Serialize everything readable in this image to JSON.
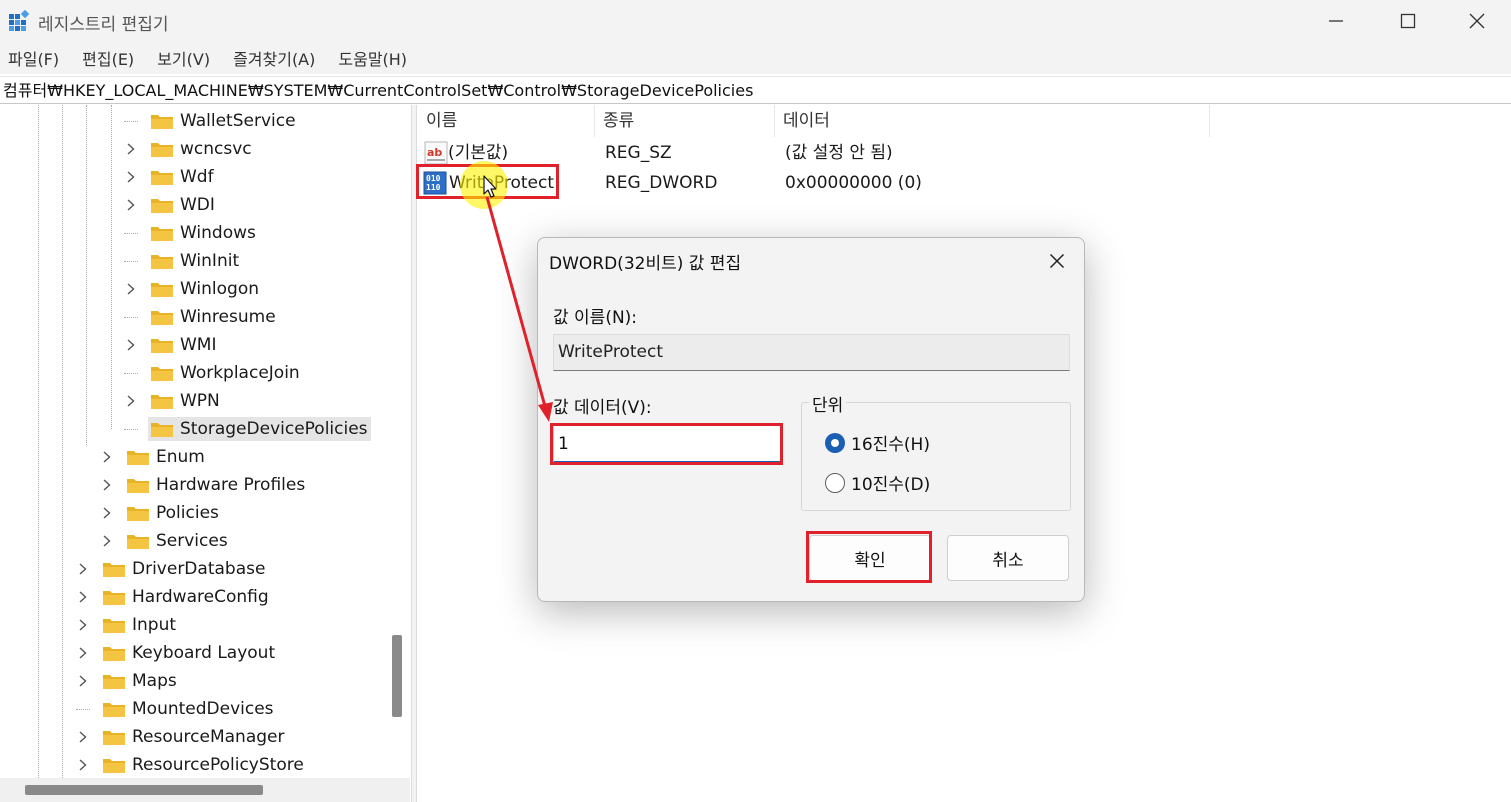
{
  "window": {
    "title": "레지스트리 편집기"
  },
  "menu": [
    "파일(F)",
    "편집(E)",
    "보기(V)",
    "즐겨찾기(A)",
    "도움말(H)"
  ],
  "address": "컴퓨터₩HKEY_LOCAL_MACHINE₩SYSTEM₩CurrentControlSet₩Control₩StorageDevicePolicies",
  "tree": {
    "items": [
      {
        "label": "WalletService",
        "expandable": false,
        "selected": false
      },
      {
        "label": "wcncsvc",
        "expandable": true,
        "selected": false
      },
      {
        "label": "Wdf",
        "expandable": true,
        "selected": false
      },
      {
        "label": "WDI",
        "expandable": true,
        "selected": false
      },
      {
        "label": "Windows",
        "expandable": false,
        "selected": false
      },
      {
        "label": "WinInit",
        "expandable": false,
        "selected": false
      },
      {
        "label": "Winlogon",
        "expandable": true,
        "selected": false
      },
      {
        "label": "Winresume",
        "expandable": false,
        "selected": false
      },
      {
        "label": "WMI",
        "expandable": true,
        "selected": false
      },
      {
        "label": "WorkplaceJoin",
        "expandable": false,
        "selected": false
      },
      {
        "label": "WPN",
        "expandable": true,
        "selected": false
      },
      {
        "label": "StorageDevicePolicies",
        "expandable": false,
        "selected": true
      },
      {
        "label": "Enum",
        "expandable": true,
        "selected": false
      },
      {
        "label": "Hardware Profiles",
        "expandable": true,
        "selected": false
      },
      {
        "label": "Policies",
        "expandable": true,
        "selected": false
      },
      {
        "label": "Services",
        "expandable": true,
        "selected": false
      },
      {
        "label": "DriverDatabase",
        "expandable": true,
        "selected": false
      },
      {
        "label": "HardwareConfig",
        "expandable": true,
        "selected": false
      },
      {
        "label": "Input",
        "expandable": true,
        "selected": false
      },
      {
        "label": "Keyboard Layout",
        "expandable": true,
        "selected": false
      },
      {
        "label": "Maps",
        "expandable": true,
        "selected": false
      },
      {
        "label": "MountedDevices",
        "expandable": false,
        "selected": false
      },
      {
        "label": "ResourceManager",
        "expandable": true,
        "selected": false
      },
      {
        "label": "ResourcePolicyStore",
        "expandable": true,
        "selected": false
      }
    ]
  },
  "values": {
    "headers": [
      "이름",
      "종류",
      "데이터"
    ],
    "rows": [
      {
        "icon": "string-value-icon",
        "name": "(기본값)",
        "type": "REG_SZ",
        "data": "(값 설정 안 됨)"
      },
      {
        "icon": "dword-value-icon",
        "name": "WriteProtect",
        "type": "REG_DWORD",
        "data": "0x00000000 (0)"
      }
    ]
  },
  "dialog": {
    "title": "DWORD(32비트) 값 편집",
    "name_label": "값 이름(N):",
    "name_value": "WriteProtect",
    "data_label": "값 데이터(V):",
    "data_value": "1",
    "base_label": "단위",
    "hex_label": "16진수(H)",
    "dec_label": "10진수(D)",
    "hex_selected": true,
    "ok_label": "확인",
    "cancel_label": "취소"
  },
  "colors": {
    "highlight": "#e0202a",
    "accent": "#1a5fb4",
    "folder": "#f4c542"
  }
}
